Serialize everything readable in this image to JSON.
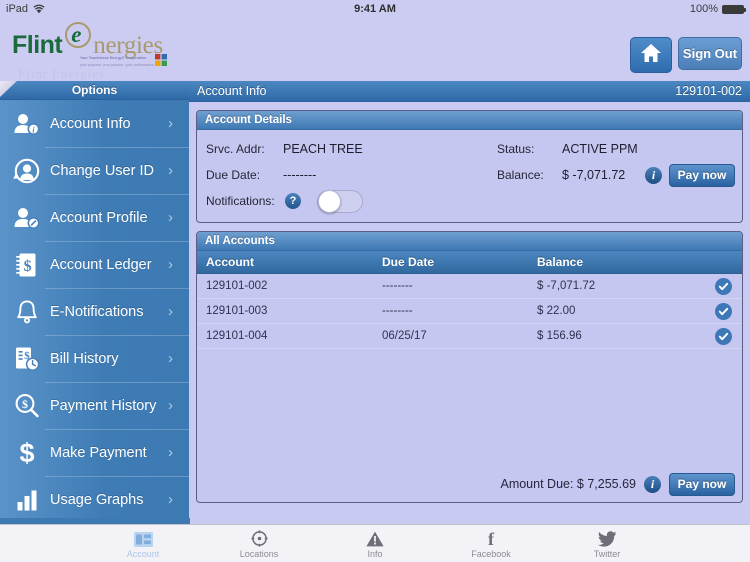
{
  "statusbar": {
    "device": "iPad",
    "wifi_icon": "wifi-icon",
    "time": "9:41 AM",
    "battery_pct": "100%",
    "battery_icon": "battery-full-icon"
  },
  "brand": {
    "logo_word1": "Flint",
    "logo_letter": "e",
    "logo_word2": "nergies",
    "tagline_line1": "Your Touchstone Energy® Cooperative",
    "tagline_line2": "your purpose. your passion. your performance.",
    "ghost_text": "Flint Energies",
    "home_icon": "home-icon",
    "signout_label": "Sign Out",
    "accent_blue": "#3f7cb5",
    "brand_green": "#1a6b3c",
    "brand_gold": "#a89a6e"
  },
  "sidebar": {
    "header": "Options",
    "items": [
      {
        "label": "Account Info",
        "icon": "person-info-icon",
        "chevron": "›"
      },
      {
        "label": "Change User ID",
        "icon": "person-refresh-icon",
        "chevron": "›"
      },
      {
        "label": "Account Profile",
        "icon": "person-edit-icon",
        "chevron": "›"
      },
      {
        "label": "Account Ledger",
        "icon": "ledger-dollar-icon",
        "chevron": "›"
      },
      {
        "label": "E-Notifications",
        "icon": "bell-icon",
        "chevron": "›"
      },
      {
        "label": "Bill History",
        "icon": "bill-clock-icon",
        "chevron": "›"
      },
      {
        "label": "Payment History",
        "icon": "dollar-search-icon",
        "chevron": "›"
      },
      {
        "label": "Make Payment",
        "icon": "dollar-sign-icon",
        "chevron": "›"
      },
      {
        "label": "Usage Graphs",
        "icon": "bar-chart-icon",
        "chevron": "›"
      }
    ]
  },
  "content": {
    "header_title": "Account Info",
    "header_account": "129101-002"
  },
  "details": {
    "panel_title": "Account Details",
    "srvc_addr_label": "Srvc. Addr:",
    "srvc_addr_value": "PEACH TREE",
    "status_label": "Status:",
    "status_value": "ACTIVE PPM",
    "due_date_label": "Due Date:",
    "due_date_value": "--------",
    "balance_label": "Balance:",
    "balance_value": "$ -7,071.72",
    "notifications_label": "Notifications:",
    "help_icon": "question-mark-icon",
    "toggle_state": "off",
    "info_icon": "info-icon",
    "pay_now_label": "Pay now"
  },
  "accounts": {
    "panel_title": "All Accounts",
    "columns": [
      "Account",
      "Due Date",
      "Balance"
    ],
    "rows": [
      {
        "account": "129101-002",
        "due_date": "--------",
        "balance": "$ -7,071.72",
        "check_icon": "check-circle-icon"
      },
      {
        "account": "129101-003",
        "due_date": "--------",
        "balance": "$ 22.00",
        "check_icon": "check-circle-icon"
      },
      {
        "account": "129101-004",
        "due_date": "06/25/17",
        "balance": "$ 156.96",
        "check_icon": "check-circle-icon"
      }
    ],
    "amount_due_text": "Amount Due: $ 7,255.69",
    "info_icon": "info-icon",
    "pay_now_label": "Pay now"
  },
  "tabbar": {
    "tabs": [
      {
        "label": "Account",
        "icon": "account-card-icon",
        "active": true
      },
      {
        "label": "Locations",
        "icon": "compass-icon",
        "active": false
      },
      {
        "label": "Info",
        "icon": "warning-icon",
        "active": false
      },
      {
        "label": "Facebook",
        "icon": "facebook-icon",
        "active": false
      },
      {
        "label": "Twitter",
        "icon": "twitter-bird-icon",
        "active": false
      }
    ]
  }
}
